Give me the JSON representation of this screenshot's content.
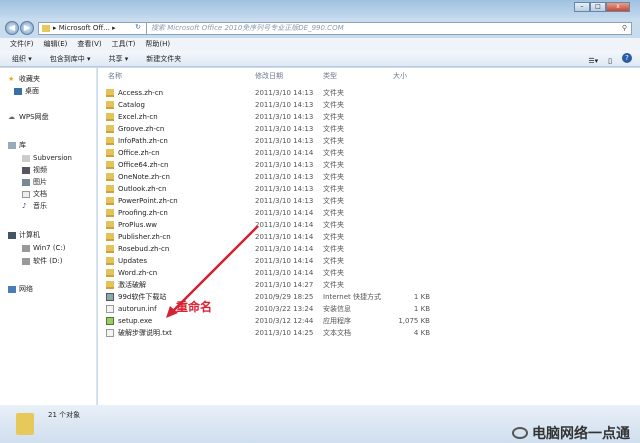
{
  "window": {
    "minimize": "–",
    "maximize": "□",
    "close": "x"
  },
  "address": {
    "path": "Microsoft Off...",
    "search_placeholder": "搜索 Microsoft Office 2010免序列号专业正版DE_990.COM"
  },
  "menu": [
    "文件(F)",
    "编辑(E)",
    "查看(V)",
    "工具(T)",
    "帮助(H)"
  ],
  "toolbar": [
    "组织 ▾",
    "包含到库中 ▾",
    "共享 ▾",
    "新建文件夹"
  ],
  "sidebar": {
    "favorites": "收藏夹",
    "desktop": "桌面",
    "wps": "WPS网盘",
    "library": "库",
    "libs": [
      "Subversion",
      "视频",
      "图片",
      "文档",
      "音乐"
    ],
    "computer": "计算机",
    "drives": [
      "Win7 (C:)",
      "软件 (D:)"
    ],
    "network": "网络"
  },
  "columns": {
    "name": "名称",
    "date": "修改日期",
    "type": "类型",
    "size": "大小"
  },
  "files": [
    {
      "name": "Access.zh-cn",
      "date": "2011/3/10 14:13",
      "type": "文件夹",
      "size": "",
      "kind": "folder"
    },
    {
      "name": "Catalog",
      "date": "2011/3/10 14:13",
      "type": "文件夹",
      "size": "",
      "kind": "folder"
    },
    {
      "name": "Excel.zh-cn",
      "date": "2011/3/10 14:13",
      "type": "文件夹",
      "size": "",
      "kind": "folder"
    },
    {
      "name": "Groove.zh-cn",
      "date": "2011/3/10 14:13",
      "type": "文件夹",
      "size": "",
      "kind": "folder"
    },
    {
      "name": "InfoPath.zh-cn",
      "date": "2011/3/10 14:13",
      "type": "文件夹",
      "size": "",
      "kind": "folder"
    },
    {
      "name": "Office.zh-cn",
      "date": "2011/3/10 14:14",
      "type": "文件夹",
      "size": "",
      "kind": "folder"
    },
    {
      "name": "Office64.zh-cn",
      "date": "2011/3/10 14:13",
      "type": "文件夹",
      "size": "",
      "kind": "folder"
    },
    {
      "name": "OneNote.zh-cn",
      "date": "2011/3/10 14:13",
      "type": "文件夹",
      "size": "",
      "kind": "folder"
    },
    {
      "name": "Outlook.zh-cn",
      "date": "2011/3/10 14:13",
      "type": "文件夹",
      "size": "",
      "kind": "folder"
    },
    {
      "name": "PowerPoint.zh-cn",
      "date": "2011/3/10 14:13",
      "type": "文件夹",
      "size": "",
      "kind": "folder"
    },
    {
      "name": "Proofing.zh-cn",
      "date": "2011/3/10 14:14",
      "type": "文件夹",
      "size": "",
      "kind": "folder"
    },
    {
      "name": "ProPlus.ww",
      "date": "2011/3/10 14:14",
      "type": "文件夹",
      "size": "",
      "kind": "folder"
    },
    {
      "name": "Publisher.zh-cn",
      "date": "2011/3/10 14:14",
      "type": "文件夹",
      "size": "",
      "kind": "folder"
    },
    {
      "name": "Rosebud.zh-cn",
      "date": "2011/3/10 14:14",
      "type": "文件夹",
      "size": "",
      "kind": "folder"
    },
    {
      "name": "Updates",
      "date": "2011/3/10 14:14",
      "type": "文件夹",
      "size": "",
      "kind": "folder"
    },
    {
      "name": "Word.zh-cn",
      "date": "2011/3/10 14:14",
      "type": "文件夹",
      "size": "",
      "kind": "folder"
    },
    {
      "name": "激活破解",
      "date": "2011/3/10 14:27",
      "type": "文件夹",
      "size": "",
      "kind": "folder"
    },
    {
      "name": "99d软件下载站",
      "date": "2010/9/29 18:25",
      "type": "Internet 快捷方式",
      "size": "1 KB",
      "kind": "link"
    },
    {
      "name": "autorun.inf",
      "date": "2010/3/22 13:24",
      "type": "安装信息",
      "size": "1 KB",
      "kind": "file"
    },
    {
      "name": "setup.exe",
      "date": "2010/3/12 12:44",
      "type": "应用程序",
      "size": "1,075 KB",
      "kind": "exe"
    },
    {
      "name": "破解步骤说明.txt",
      "date": "2011/3/10 14:25",
      "type": "文本文档",
      "size": "4 KB",
      "kind": "file"
    }
  ],
  "annotation": "重命名",
  "status": {
    "count": "21 个对象"
  },
  "watermark": "电脑网络一点通",
  "colors": {
    "annotation": "#d22233"
  }
}
